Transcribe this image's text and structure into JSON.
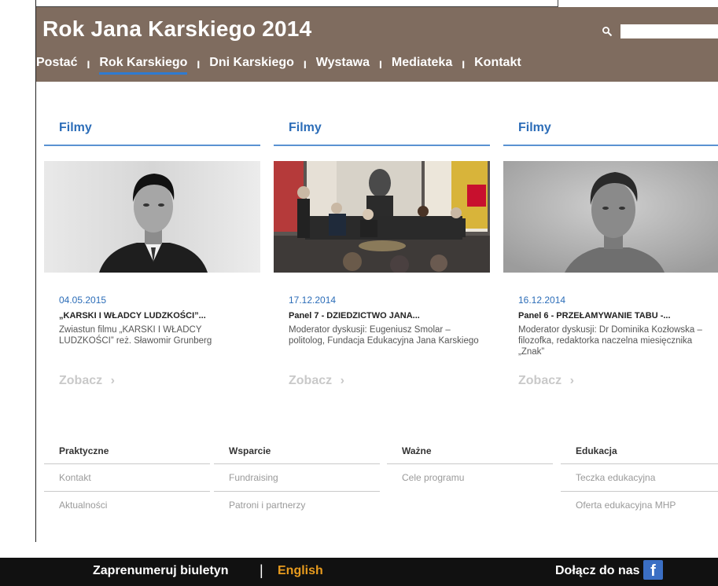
{
  "header": {
    "site_title": "Rok Jana Karskiego 2014",
    "search": {
      "value": "",
      "placeholder": ""
    },
    "nav": [
      {
        "label": "Postać"
      },
      {
        "label": "Rok Karskiego",
        "active": true
      },
      {
        "label": "Dni Karskiego"
      },
      {
        "label": "Wystawa"
      },
      {
        "label": "Mediateka"
      },
      {
        "label": "Kontakt"
      }
    ],
    "nav_separator": "I"
  },
  "cards": [
    {
      "heading": "Filmy",
      "date": "04.05.2015",
      "title": "„KARSKI I WŁADCY LUDZKOŚCI”...",
      "description": "Zwiastun filmu „KARSKI I WŁADCY LUDZKOŚCI” reż. Sławomir Grunberg",
      "more": "Zobacz",
      "image": "portrait-photo"
    },
    {
      "heading": "Filmy",
      "date": "17.12.2014",
      "title": "Panel 7 - DZIEDZICTWO JANA...",
      "description": "Moderator dyskusji: Eugeniusz Smolar – politolog, Fundacja Edukacyjna Jana Karskiego",
      "more": "Zobacz",
      "image": "panel-discussion-photo"
    },
    {
      "heading": "Filmy",
      "date": "16.12.2014",
      "title": "Panel 6 - PRZEŁAMYWANIE TABU -...",
      "description": "Moderator dyskusji: Dr Dominika Kozłowska – filozofka, redaktorka naczelna miesięcznika „Znak”",
      "more": "Zobacz",
      "image": "portrait-photo"
    }
  ],
  "footer_columns": [
    {
      "heading": "Praktyczne",
      "links": [
        "Kontakt",
        "Aktualności"
      ]
    },
    {
      "heading": "Wsparcie",
      "links": [
        "Fundraising",
        "Patroni i partnerzy"
      ]
    },
    {
      "heading": "Ważne",
      "links": [
        "Cele programu"
      ]
    },
    {
      "heading": "Edukacja",
      "links": [
        "Teczka edukacyjna",
        "Oferta edukacyjna MHP"
      ]
    }
  ],
  "bottom_bar": {
    "subscribe": "Zaprenumeruj biuletyn",
    "separator": "|",
    "english": "English",
    "join": "Dołącz do nas",
    "facebook_icon": "facebook-icon",
    "facebook_letter": "f"
  },
  "colors": {
    "header_bg": "#7f6c5f",
    "accent_blue": "#2c6db8",
    "english_orange": "#e89b1e",
    "bottom_bar_bg": "#111111"
  }
}
